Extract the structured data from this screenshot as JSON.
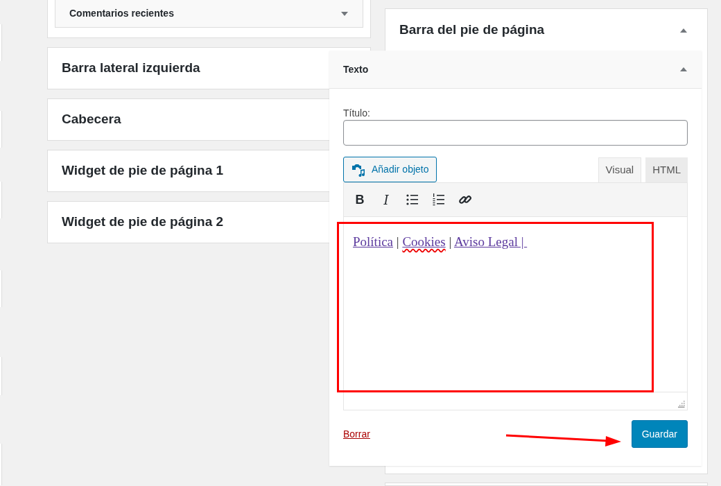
{
  "left_column": {
    "open_sidebar": {
      "widget": {
        "title": "Comentarios recientes",
        "expanded": false
      }
    },
    "sidebars": [
      {
        "title": "Barra lateral izquierda"
      },
      {
        "title": "Cabecera"
      },
      {
        "title": "Widget de pie de página 1"
      },
      {
        "title": "Widget de pie de página 2"
      }
    ]
  },
  "right_column": {
    "sidebar": {
      "title": "Barra del pie de página",
      "expanded": true
    }
  },
  "widget_panel": {
    "title": "Texto",
    "expanded": true,
    "title_field": {
      "label": "Título:"
    },
    "add_media_button": "Añadir objeto",
    "editor_tabs": [
      {
        "label": "Visual",
        "selected": true
      },
      {
        "label": "HTML",
        "selected": false
      }
    ],
    "toolbar": [
      {
        "kind": "bold",
        "label": "B"
      },
      {
        "kind": "italic",
        "label": "I"
      },
      {
        "kind": "bullet-list"
      },
      {
        "kind": "numbered-list"
      },
      {
        "kind": "link"
      }
    ],
    "content": [
      {
        "kind": "link",
        "text": "Política",
        "misspelled": false
      },
      {
        "kind": "text",
        "text": " | "
      },
      {
        "kind": "link",
        "text": "Cookies",
        "misspelled": true
      },
      {
        "kind": "text",
        "text": " | "
      },
      {
        "kind": "link",
        "text": "Aviso Legal | ",
        "misspelled": false
      }
    ],
    "delete_link": "Borrar",
    "save_button": "Guardar"
  }
}
